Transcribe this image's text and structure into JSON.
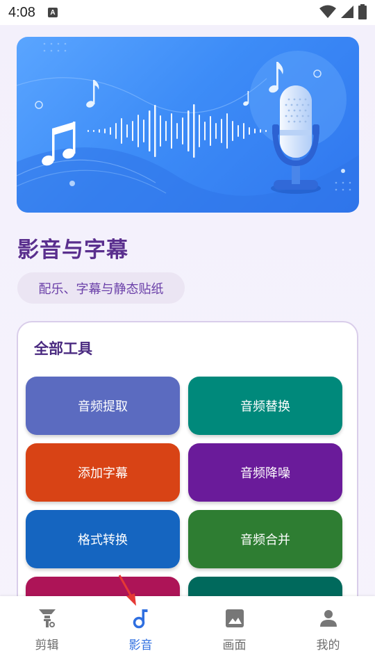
{
  "status_bar": {
    "time": "4:08",
    "notification_icon": "A"
  },
  "banner": {
    "icons": [
      "music-note-icon",
      "sound-wave-icon",
      "microphone-icon"
    ]
  },
  "page": {
    "title": "影音与字幕",
    "subtitle": "配乐、字幕与静态贴纸"
  },
  "tools": {
    "title": "全部工具",
    "items": [
      {
        "label": "音频提取",
        "color": "#5b6bc0"
      },
      {
        "label": "音频替换",
        "color": "#00897b"
      },
      {
        "label": "添加字幕",
        "color": "#d84315"
      },
      {
        "label": "音频降噪",
        "color": "#6a1b9a"
      },
      {
        "label": "格式转换",
        "color": "#1565c0"
      },
      {
        "label": "音频合并",
        "color": "#2e7d32"
      },
      {
        "label": "",
        "color": "#ad1457"
      },
      {
        "label": "",
        "color": "#00695c"
      }
    ]
  },
  "bottom_nav": {
    "items": [
      {
        "label": "剪辑",
        "icon": "cut-icon",
        "active": false
      },
      {
        "label": "影音",
        "icon": "music-note-icon",
        "active": true
      },
      {
        "label": "画面",
        "icon": "image-icon",
        "active": false
      },
      {
        "label": "我的",
        "icon": "person-icon",
        "active": false
      }
    ]
  },
  "colors": {
    "accent": "#2f6fe0",
    "title": "#5a2f8e"
  }
}
